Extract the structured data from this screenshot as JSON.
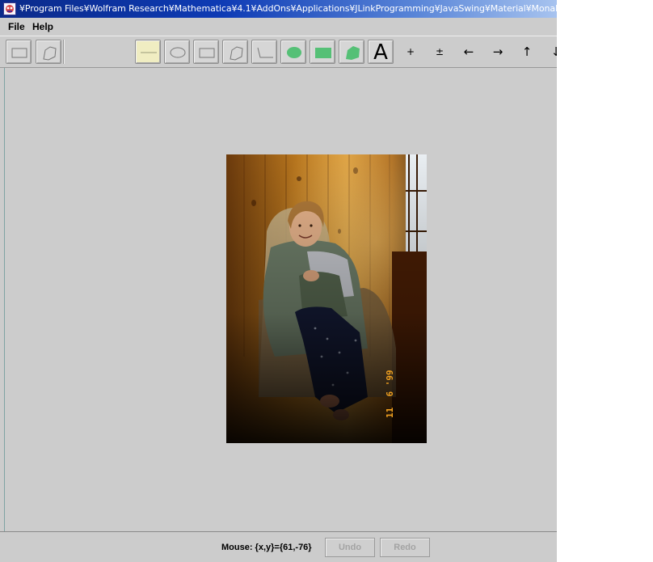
{
  "window": {
    "title": "¥Program Files¥Wolfram Research¥Mathematica¥4.1¥AddOns¥Applications¥JLinkProgramming¥JavaSwing¥Material¥MonaLisa.gif"
  },
  "menubar": {
    "items": [
      {
        "label": "File"
      },
      {
        "label": "Help"
      }
    ]
  },
  "toolbar": {
    "buttons": [
      {
        "name": "select-rectangle-tool",
        "icon": "rectangle-outline-icon"
      },
      {
        "name": "select-polygon-tool",
        "icon": "polygon-outline-icon"
      },
      {
        "name": "line-tool",
        "icon": "line-icon",
        "selected": true
      },
      {
        "name": "ellipse-tool",
        "icon": "ellipse-outline-icon"
      },
      {
        "name": "rectangle-tool",
        "icon": "rectangle-outline-icon"
      },
      {
        "name": "polygon-tool",
        "icon": "polygon-outline-icon"
      },
      {
        "name": "polyline-tool",
        "icon": "polyline-icon"
      },
      {
        "name": "filled-ellipse-tool",
        "icon": "filled-ellipse-icon"
      },
      {
        "name": "filled-rectangle-tool",
        "icon": "filled-rectangle-icon"
      },
      {
        "name": "filled-polygon-tool",
        "icon": "filled-polygon-icon"
      },
      {
        "name": "text-tool",
        "icon": "text-icon",
        "label": "A"
      }
    ],
    "glyph_buttons": [
      {
        "name": "zoom-in-button",
        "label": "+"
      },
      {
        "name": "zoom-out-button",
        "label": "±"
      },
      {
        "name": "move-left-button",
        "label": "←"
      },
      {
        "name": "move-right-button",
        "label": "→"
      },
      {
        "name": "move-up-button",
        "label": "↑"
      },
      {
        "name": "move-down-button",
        "label": "↓"
      }
    ],
    "fill_color": "#55c076"
  },
  "photo": {
    "date_stamp": "11  6 '99"
  },
  "status": {
    "mouse_text": "Mouse: {x,y}={61,-76}",
    "undo_label": "Undo",
    "redo_label": "Redo"
  }
}
